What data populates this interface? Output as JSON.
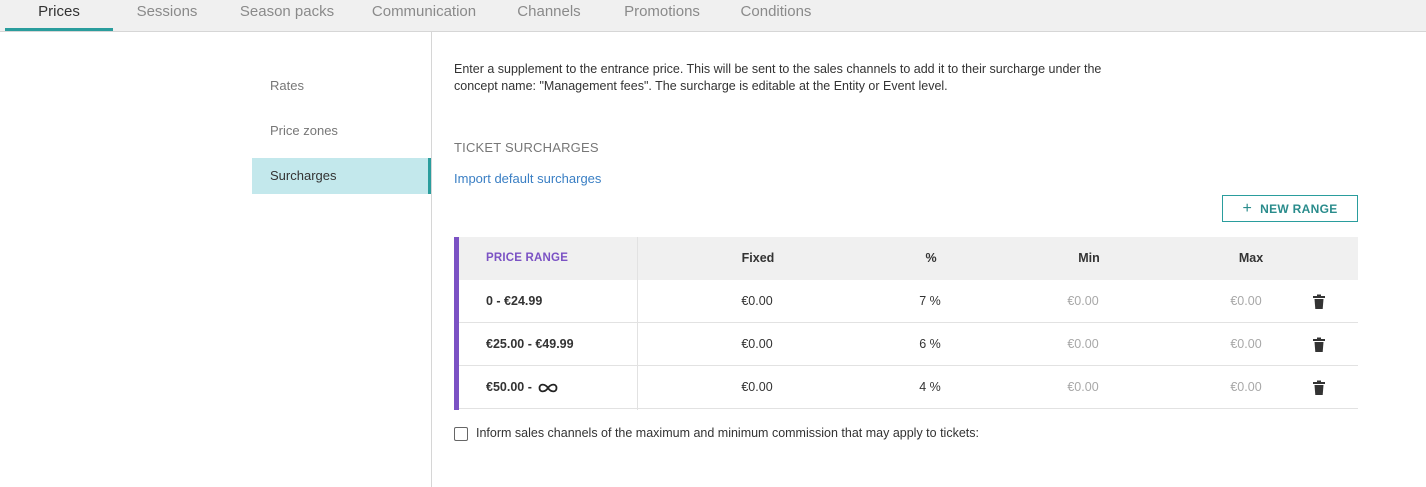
{
  "tabs": [
    {
      "label": "Prices",
      "active": true
    },
    {
      "label": "Sessions"
    },
    {
      "label": "Season packs"
    },
    {
      "label": "Communication"
    },
    {
      "label": "Channels"
    },
    {
      "label": "Promotions"
    },
    {
      "label": "Conditions"
    }
  ],
  "sidebar": {
    "items": [
      {
        "label": "Rates"
      },
      {
        "label": "Price zones"
      },
      {
        "label": "Surcharges",
        "active": true
      }
    ]
  },
  "description": "Enter a supplement to the entrance price. This will be sent to the sales channels to add it to their surcharge under the concept name: \"Management fees\". The surcharge is editable at the Entity or Event level.",
  "section_title": "TICKET SURCHARGES",
  "import_link": "Import default surcharges",
  "new_range_button": {
    "icon": "plus-icon",
    "label": "NEW RANGE"
  },
  "table": {
    "headers": {
      "price_range": "PRICE RANGE",
      "fixed": "Fixed",
      "percent": "%",
      "min": "Min",
      "max": "Max"
    },
    "rows": [
      {
        "range": "0 - €24.99",
        "fixed": "€0.00",
        "percent": "7 %",
        "min": "€0.00",
        "max": "€0.00"
      },
      {
        "range": "€25.00 - €49.99",
        "fixed": "€0.00",
        "percent": "6 %",
        "min": "€0.00",
        "max": "€0.00"
      },
      {
        "range": "€50.00 -",
        "range_end_icon": "infinity-icon",
        "fixed": "€0.00",
        "percent": "4 %",
        "min": "€0.00",
        "max": "€0.00"
      }
    ]
  },
  "checkbox": {
    "label": "Inform sales channels of the maximum and minimum commission that may apply to tickets:",
    "checked": false
  },
  "colors": {
    "accent": "#2a9d9d",
    "purple": "#7b52c4",
    "link": "#3a7fc4",
    "sidebar_active_bg": "#c3e8ec"
  }
}
